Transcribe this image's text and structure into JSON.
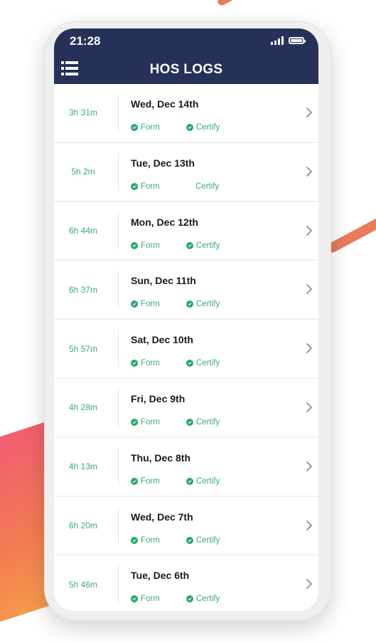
{
  "status_bar": {
    "time": "21:28"
  },
  "header": {
    "title": "HOS LOGS",
    "menu_icon": "list-menu-icon"
  },
  "colors": {
    "header_bg": "#253159",
    "accent_green": "#3daa74",
    "check_green": "#27a86a"
  },
  "logs": [
    {
      "duration": "3h 31m",
      "date": "Wed, Dec 14th",
      "form_label": "Form",
      "certify_label": "Certify",
      "form_checked": true,
      "certify_checked": true
    },
    {
      "duration": "5h 2m",
      "date": "Tue, Dec 13th",
      "form_label": "Form",
      "certify_label": "Certify",
      "form_checked": true,
      "certify_checked": false
    },
    {
      "duration": "6h 44m",
      "date": "Mon, Dec 12th",
      "form_label": "Form",
      "certify_label": "Certify",
      "form_checked": true,
      "certify_checked": true
    },
    {
      "duration": "6h 37m",
      "date": "Sun, Dec 11th",
      "form_label": "Form",
      "certify_label": "Certify",
      "form_checked": true,
      "certify_checked": true
    },
    {
      "duration": "5h 57m",
      "date": "Sat, Dec 10th",
      "form_label": "Form",
      "certify_label": "Certify",
      "form_checked": true,
      "certify_checked": true
    },
    {
      "duration": "4h 28m",
      "date": "Fri, Dec 9th",
      "form_label": "Form",
      "certify_label": "Certify",
      "form_checked": true,
      "certify_checked": true
    },
    {
      "duration": "4h 13m",
      "date": "Thu, Dec 8th",
      "form_label": "Form",
      "certify_label": "Certify",
      "form_checked": true,
      "certify_checked": true
    },
    {
      "duration": "6h 20m",
      "date": "Wed, Dec 7th",
      "form_label": "Form",
      "certify_label": "Certify",
      "form_checked": true,
      "certify_checked": true
    },
    {
      "duration": "5h 46m",
      "date": "Tue, Dec 6th",
      "form_label": "Form",
      "certify_label": "Certify",
      "form_checked": true,
      "certify_checked": true
    }
  ]
}
